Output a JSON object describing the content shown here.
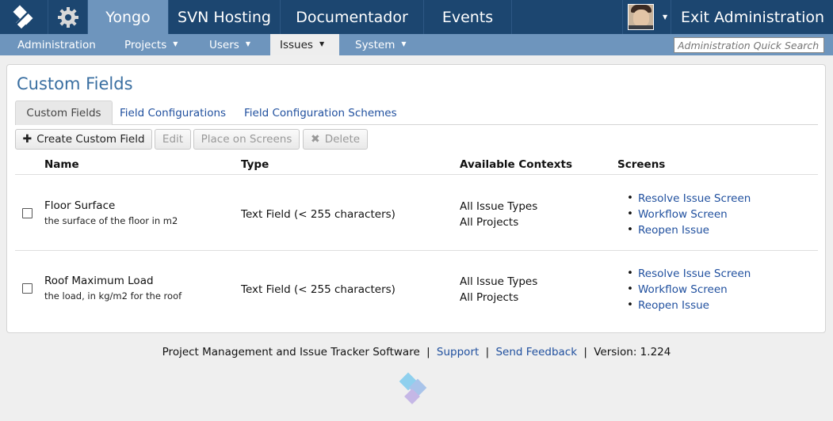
{
  "topnav": {
    "tabs": [
      "Yongo",
      "SVN Hosting",
      "Documentador",
      "Events"
    ],
    "exit_label": "Exit Administration"
  },
  "subnav": {
    "items": [
      "Administration",
      "Projects",
      "Users",
      "Issues",
      "System"
    ],
    "search_placeholder": "Administration Quick Search"
  },
  "page": {
    "title": "Custom Fields",
    "tabs": [
      "Custom Fields",
      "Field Configurations",
      "Field Configuration Schemes"
    ],
    "buttons": {
      "create": "Create Custom Field",
      "edit": "Edit",
      "place": "Place on Screens",
      "delete": "Delete"
    }
  },
  "table": {
    "headers": [
      "Name",
      "Type",
      "Available Contexts",
      "Screens"
    ],
    "rows": [
      {
        "name": "Floor Surface",
        "description": "the surface of the floor in m2",
        "type": "Text Field (< 255 characters)",
        "contexts": [
          "All Issue Types",
          "All Projects"
        ],
        "screens": [
          "Resolve Issue Screen",
          "Workflow Screen",
          "Reopen Issue"
        ]
      },
      {
        "name": "Roof Maximum Load",
        "description": "the load, in kg/m2 for the roof",
        "type": "Text Field (< 255 characters)",
        "contexts": [
          "All Issue Types",
          "All Projects"
        ],
        "screens": [
          "Resolve Issue Screen",
          "Workflow Screen",
          "Reopen Issue"
        ]
      }
    ]
  },
  "footer": {
    "text": "Project Management and Issue Tracker Software",
    "sep": "|",
    "support": "Support",
    "feedback": "Send Feedback",
    "version": "Version: 1.224"
  },
  "colors": {
    "topbar": "#1c4670",
    "subnav": "#6e95bd",
    "link": "#1f4f9e",
    "title": "#3a6fa1"
  }
}
